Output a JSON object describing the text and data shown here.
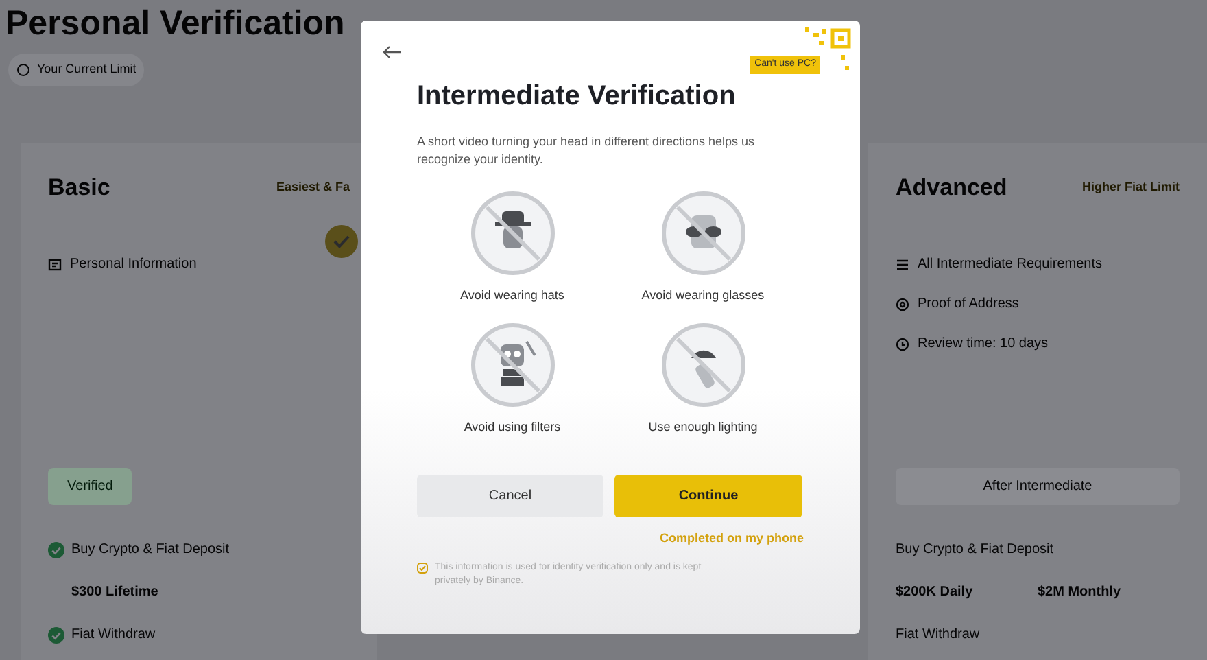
{
  "page": {
    "title": "Personal Verification",
    "current_limit": "Your Current Limit"
  },
  "tiers": [
    {
      "name": "Basic",
      "tag": "Easiest & Fa",
      "requirements": [
        {
          "kind": "id",
          "text": "Personal Information"
        }
      ],
      "status": {
        "label": "Verified",
        "kind": "verified"
      },
      "limits": [
        {
          "label": "Buy Crypto & Fiat Deposit",
          "checked": true,
          "values": [
            "$300 Lifetime"
          ]
        },
        {
          "label": "Fiat Withdraw",
          "checked": true
        }
      ]
    },
    {
      "name": "Advanced",
      "tag": "Higher Fiat Limit",
      "requirements": [
        {
          "kind": "list",
          "text": "All Intermediate Requirements"
        },
        {
          "kind": "location",
          "text": "Proof of Address"
        },
        {
          "kind": "clock",
          "text": "Review time: 10 days"
        }
      ],
      "status": {
        "label": "After Intermediate",
        "kind": "locked"
      },
      "limits": [
        {
          "label": "Buy Crypto & Fiat Deposit",
          "checked": false,
          "values": [
            "$200K Daily",
            "$2M Monthly"
          ]
        },
        {
          "label": "Fiat Withdraw",
          "checked": false
        }
      ]
    }
  ],
  "modal": {
    "badge": "Can't use PC?",
    "title": "Intermediate Verification",
    "description": "A short video turning your head in different directions helps us recognize your identity.",
    "tips": [
      {
        "kind": "hat",
        "label": "Avoid wearing hats"
      },
      {
        "kind": "glasses",
        "label": "Avoid wearing glasses"
      },
      {
        "kind": "filter",
        "label": "Avoid using filters"
      },
      {
        "kind": "light",
        "label": "Use enough lighting"
      }
    ],
    "cancel": "Cancel",
    "continue": "Continue",
    "phone_link": "Completed on my phone",
    "note": "This information is used for identity verification only and is kept privately by Binance."
  }
}
